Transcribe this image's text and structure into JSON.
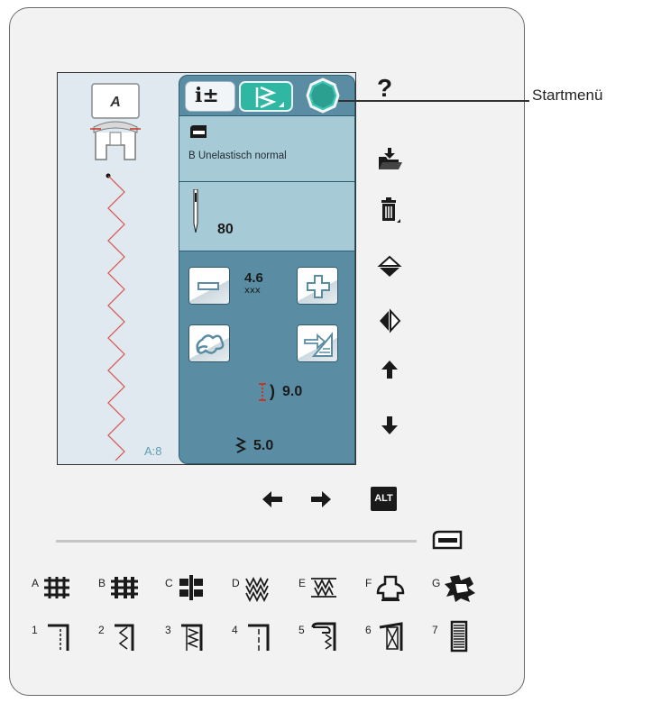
{
  "callout": {
    "label": "Startmenü"
  },
  "screen": {
    "foot_letter": "A",
    "stitch_id": "A:8",
    "fabric_label": "B Unelastisch normal",
    "needle_size": "80",
    "stitch_width": "4.6",
    "stitch_width_symbol": "ⅹⅹⅹ",
    "stitch_length": "9.0",
    "stitch_density": "5.0",
    "tab_info_label": "i±"
  },
  "side_buttons": {
    "help": "?",
    "alt": "ALT"
  },
  "nav": {
    "left": "🡐",
    "right": "🡒"
  },
  "stitch_types": [
    {
      "label": "A"
    },
    {
      "label": "B"
    },
    {
      "label": "C"
    },
    {
      "label": "D"
    },
    {
      "label": "E"
    },
    {
      "label": "F"
    },
    {
      "label": "G"
    }
  ],
  "stitch_numbers": [
    {
      "label": "1"
    },
    {
      "label": "2"
    },
    {
      "label": "3"
    },
    {
      "label": "4"
    },
    {
      "label": "5"
    },
    {
      "label": "6"
    },
    {
      "label": "7"
    }
  ],
  "colors": {
    "panel_blue": "#5a8da3",
    "info_bg": "#a6cbd7",
    "tab_green": "#2fb7a4",
    "stitch_red": "#d9534f"
  }
}
